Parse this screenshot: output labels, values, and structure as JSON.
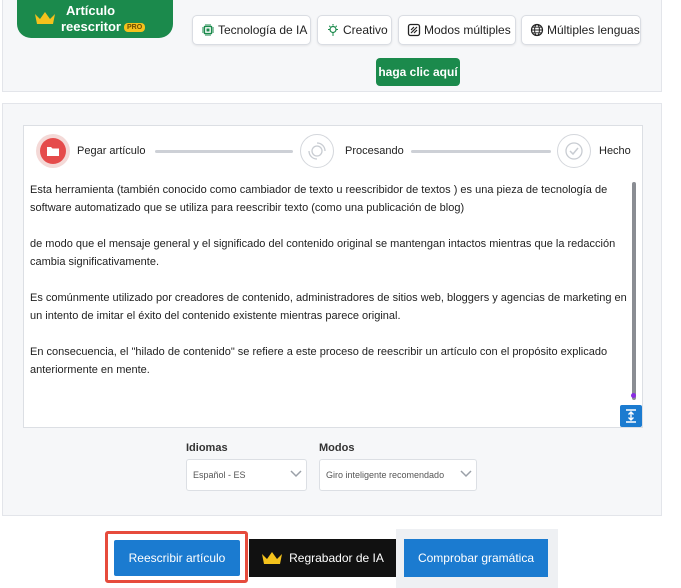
{
  "badge": {
    "line1": "Artículo",
    "line2": "reescritor",
    "pro": "PRO",
    "icon": "crown-icon",
    "color": "#1b8a4c"
  },
  "chips": {
    "ia": "Tecnología de IA",
    "creativo": "Creativo",
    "modos": "Modos múltiples",
    "lenguas": "Múltiples lenguas"
  },
  "cta": "haga clic aquí",
  "steps": {
    "paste": "Pegar artículo",
    "processing": "Procesando",
    "done": "Hecho"
  },
  "content": {
    "p1": "Esta herramienta (también conocido como cambiador de texto u reescribidor de textos ) es una pieza de tecnología de software automatizado que se utiliza para reescribir texto (como una publicación de blog)",
    "p2": "de modo que el mensaje general y el significado del contenido original se mantengan intactos mientras que la redacción cambia significativamente.",
    "p3": "Es comúnmente utilizado por creadores de contenido, administradores de sitios web, bloggers y agencias de marketing en un intento de imitar el éxito del contenido existente mientras parece original.",
    "p4": "En consecuencia, el \"hilado de contenido\" se refiere a este proceso de reescribir un artículo con el propósito explicado anteriormente en mente."
  },
  "options": {
    "idiomas_label": "Idiomas",
    "idiomas_value": "Español - ES",
    "modos_label": "Modos",
    "modos_value": "Giro inteligente recomendado"
  },
  "buttons": {
    "rewrite": "Reescribir artículo",
    "ia": "Regrabador de IA",
    "grammar": "Comprobar gramática"
  },
  "colors": {
    "green": "#1b8a4c",
    "blue": "#1b7bd0",
    "red": "#e54b4b",
    "highlight": "#e64b3c",
    "gold": "#f4c21c"
  }
}
